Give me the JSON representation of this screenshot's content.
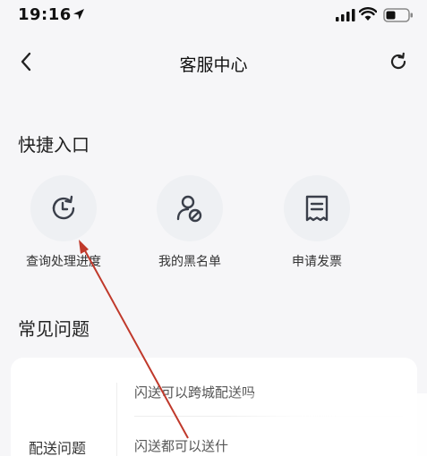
{
  "status_bar": {
    "time": "19:16",
    "icons": [
      "location-arrow-icon",
      "signal-icon",
      "wifi-icon",
      "battery-icon"
    ]
  },
  "nav": {
    "title": "客服中心",
    "back_icon": "chevron-left-icon",
    "refresh_icon": "refresh-icon"
  },
  "quick_entry": {
    "title": "快捷入口",
    "items": [
      {
        "label": "查询处理进度",
        "icon": "clock-refresh-icon"
      },
      {
        "label": "我的黑名单",
        "icon": "user-blocked-icon"
      },
      {
        "label": "申请发票",
        "icon": "receipt-icon"
      }
    ]
  },
  "faq": {
    "title": "常见问题",
    "category": "配送问题",
    "questions": [
      "闪送可以跨城配送吗",
      "闪送都可以送什"
    ]
  },
  "colors": {
    "background": "#f6f6f8",
    "card": "#ffffff",
    "icon_circle": "#eef0f3",
    "annotation_arrow": "#c0392b"
  }
}
